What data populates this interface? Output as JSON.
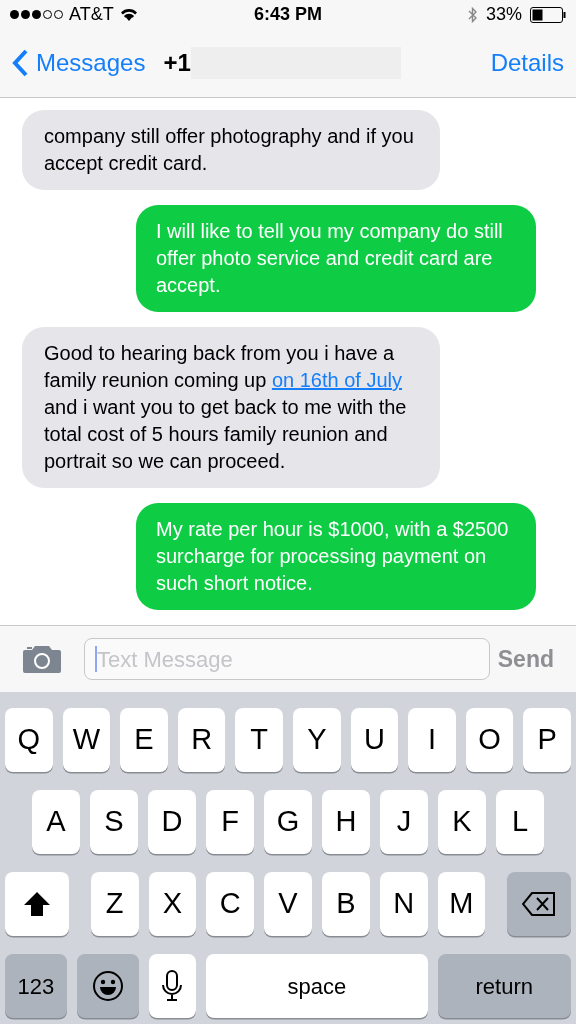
{
  "status_bar": {
    "carrier": "AT&T",
    "time": "6:43 PM",
    "battery": "33%"
  },
  "nav": {
    "back": "Messages",
    "title": "+1",
    "action": "Details"
  },
  "messages": [
    {
      "kind": "received",
      "parts": [
        {
          "text": "company still offer photography and if you accept credit card.",
          "link": false
        }
      ]
    },
    {
      "kind": "sent",
      "parts": [
        {
          "text": "I will like to tell you my company do still offer photo service and credit card are accept.",
          "link": false
        }
      ]
    },
    {
      "kind": "received",
      "parts": [
        {
          "text": "Good to hearing back from you i have a family reunion coming up ",
          "link": false
        },
        {
          "text": "on 16th of July",
          "link": true
        },
        {
          "text": " and i want you to get back to me with the total cost of 5 hours family reunion and portrait so we can proceed.",
          "link": false
        }
      ]
    },
    {
      "kind": "sent",
      "parts": [
        {
          "text": "My rate per hour is $1000, with a $2500 surcharge for processing payment on such short notice.",
          "link": false
        }
      ]
    }
  ],
  "input": {
    "placeholder": "Text Message",
    "send": "Send",
    "send_enabled": false
  },
  "keyboard": {
    "rows": [
      {
        "keys": [
          {
            "kind": "letter",
            "label": "Q"
          },
          {
            "kind": "letter",
            "label": "W"
          },
          {
            "kind": "letter",
            "label": "E"
          },
          {
            "kind": "letter",
            "label": "R"
          },
          {
            "kind": "letter",
            "label": "T"
          },
          {
            "kind": "letter",
            "label": "Y"
          },
          {
            "kind": "letter",
            "label": "U"
          },
          {
            "kind": "letter",
            "label": "I"
          },
          {
            "kind": "letter",
            "label": "O"
          },
          {
            "kind": "letter",
            "label": "P"
          }
        ]
      },
      {
        "keys": [
          {
            "kind": "letter",
            "label": "A"
          },
          {
            "kind": "letter",
            "label": "S"
          },
          {
            "kind": "letter",
            "label": "D"
          },
          {
            "kind": "letter",
            "label": "F"
          },
          {
            "kind": "letter",
            "label": "G"
          },
          {
            "kind": "letter",
            "label": "H"
          },
          {
            "kind": "letter",
            "label": "J"
          },
          {
            "kind": "letter",
            "label": "K"
          },
          {
            "kind": "letter",
            "label": "L"
          }
        ]
      },
      {
        "keys": [
          {
            "kind": "shift"
          },
          {
            "kind": "letter",
            "label": "Z"
          },
          {
            "kind": "letter",
            "label": "X"
          },
          {
            "kind": "letter",
            "label": "C"
          },
          {
            "kind": "letter",
            "label": "V"
          },
          {
            "kind": "letter",
            "label": "B"
          },
          {
            "kind": "letter",
            "label": "N"
          },
          {
            "kind": "letter",
            "label": "M"
          },
          {
            "kind": "delete"
          }
        ]
      },
      {
        "keys": [
          {
            "kind": "numbers",
            "label": "123"
          },
          {
            "kind": "emoji"
          },
          {
            "kind": "mic"
          },
          {
            "kind": "space",
            "label": "space"
          },
          {
            "kind": "return",
            "label": "return"
          }
        ]
      }
    ]
  }
}
